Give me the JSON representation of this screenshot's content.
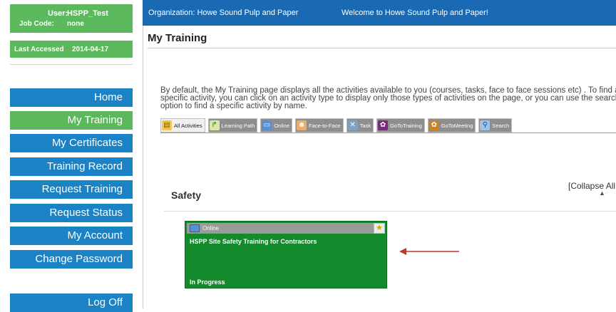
{
  "user": {
    "user_label": "User:",
    "user_value": "HSPP_Test",
    "job_label": "Job Code:",
    "job_value": "none",
    "last_accessed_label": "Last Accessed",
    "last_accessed_value": "2014-04-17"
  },
  "nav": {
    "items": [
      {
        "label": "Home"
      },
      {
        "label": "My Training"
      },
      {
        "label": "My Certificates"
      },
      {
        "label": "Training Record"
      },
      {
        "label": "Request Training"
      },
      {
        "label": "Request Status"
      },
      {
        "label": "My Account"
      },
      {
        "label": "Change Password"
      }
    ],
    "logoff": "Log Off",
    "active_index": 1
  },
  "header": {
    "organization": "Organization: Howe Sound Pulp and Paper",
    "welcome": "Welcome to Howe Sound Pulp and Paper!"
  },
  "page": {
    "title": "My Training",
    "intro": "By default, the My Training page displays all the activities available to you (courses, tasks, face to face sessions etc) . To find a specific activity, you can click on an activity type to display only those types of activities on the page, or you can use the search option to find a specific activity by name."
  },
  "filters": [
    {
      "label": "All Activities",
      "icon": "all-activities-icon"
    },
    {
      "label": "Learning Path",
      "icon": "learning-path-icon"
    },
    {
      "label": "Online",
      "icon": "online-icon"
    },
    {
      "label": "Face-to-Face",
      "icon": "face-to-face-icon"
    },
    {
      "label": "Task",
      "icon": "task-icon"
    },
    {
      "label": "GoToTraining",
      "icon": "gototraining-icon"
    },
    {
      "label": "GoToMeeting",
      "icon": "gotomeeting-icon"
    },
    {
      "label": "Search",
      "icon": "search-icon"
    }
  ],
  "collapse_all": "[Collapse All",
  "section": {
    "title": "Safety",
    "toggle_glyph": "▲"
  },
  "card": {
    "type_label": "Online",
    "title": "HSPP Site Safety Training for Contractors",
    "status": "In Progress",
    "badge_glyph": "★"
  },
  "colors": {
    "nav_blue": "#1a82c5",
    "nav_active_green": "#5cb85c",
    "topbar_blue": "#1a6ab3",
    "card_green": "#138a2c",
    "arrow_red": "#c0392b"
  }
}
